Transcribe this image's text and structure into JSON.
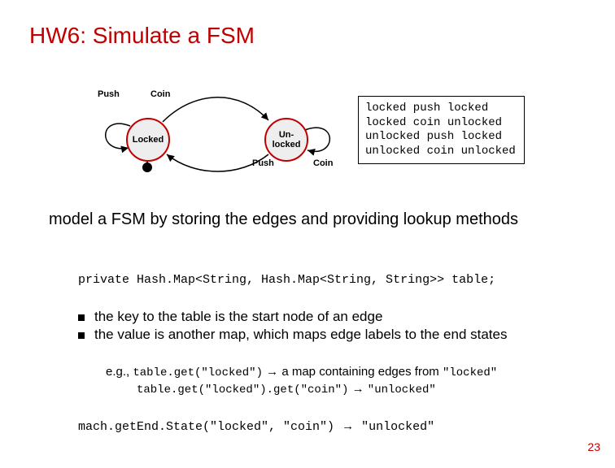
{
  "title": "HW6: Simulate a FSM",
  "diagram": {
    "state_locked": "Locked",
    "state_unlocked": "Un-\nlocked",
    "label_push_left": "Push",
    "label_coin_top": "Coin",
    "label_push_bottom": "Push",
    "label_coin_right": "Coin"
  },
  "transitions": {
    "line1": "locked push locked",
    "line2": "locked coin unlocked",
    "line3": "unlocked push locked",
    "line4": "unlocked coin unlocked"
  },
  "body_text": "model a FSM by storing the edges and providing lookup methods",
  "code_line": "private Hash.Map<String, Hash.Map<String, String>> table;",
  "bullet1": "the key to the table is the start node of an edge",
  "bullet2": "the value is another map, which maps edge labels to the end states",
  "example": {
    "prefix": "e.g., ",
    "ex1_code": "table.get(\"locked\")",
    "ex1_after": " a map containing edges from ",
    "ex1_tail": "\"locked\"",
    "ex2_code": "table.get(\"locked\").get(\"coin\")",
    "ex2_result": "\"unlocked\""
  },
  "call": {
    "code": "mach.getEnd.State(\"locked\", \"coin\")",
    "result": "\"unlocked\""
  },
  "arrow": "→",
  "page": "23"
}
